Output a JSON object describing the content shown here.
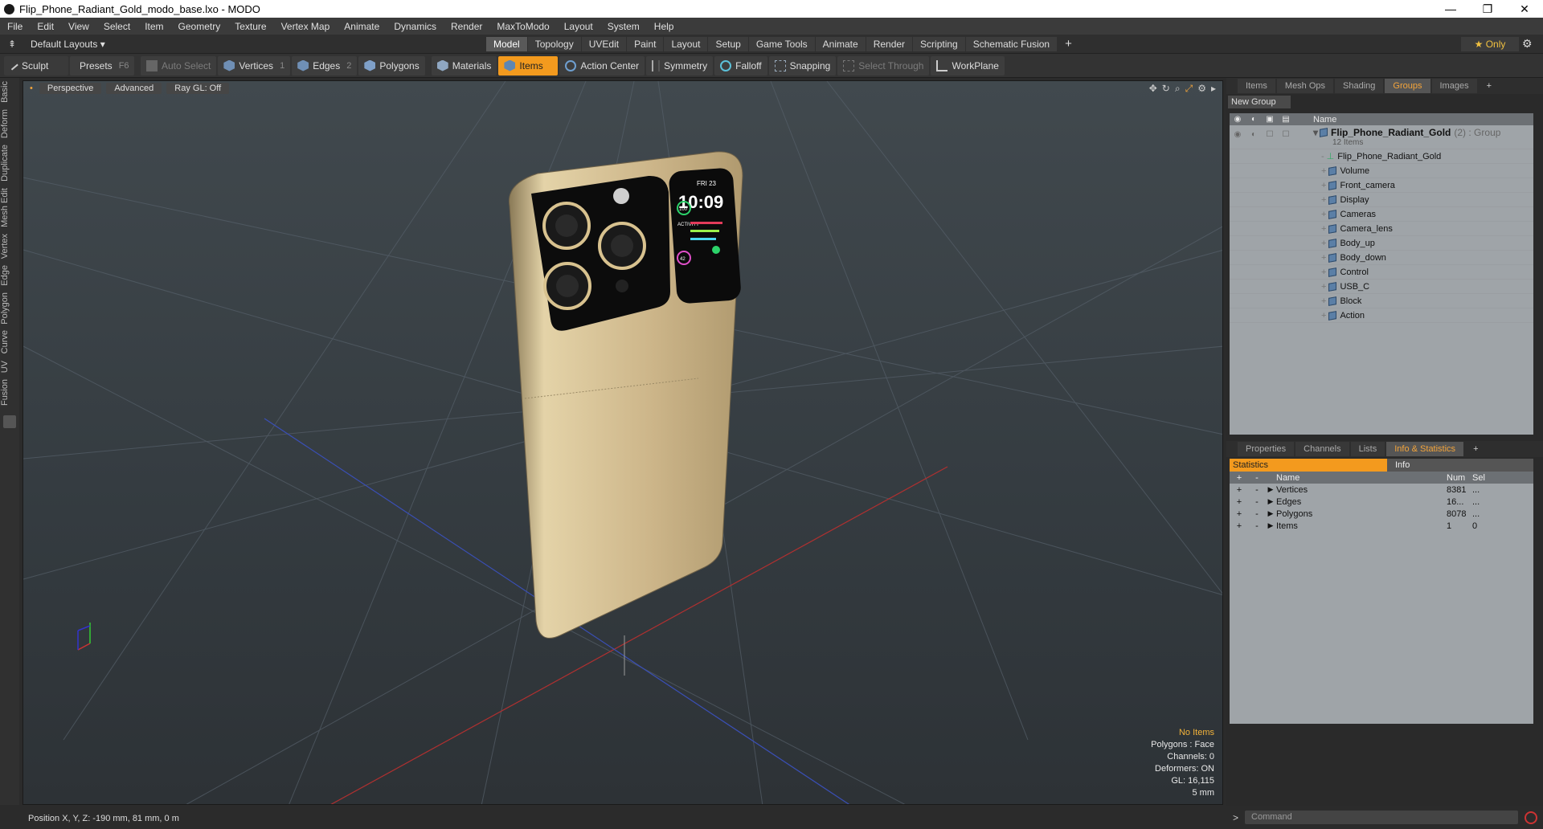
{
  "window": {
    "title": "Flip_Phone_Radiant_Gold_modo_base.lxo - MODO",
    "minimize": "—",
    "maximize": "❐",
    "close": "✕"
  },
  "menu": [
    "File",
    "Edit",
    "View",
    "Select",
    "Item",
    "Geometry",
    "Texture",
    "Vertex Map",
    "Animate",
    "Dynamics",
    "Render",
    "MaxToModo",
    "Layout",
    "System",
    "Help"
  ],
  "layout": {
    "label": "Default Layouts ▾",
    "tabs": [
      "Model",
      "Topology",
      "UVEdit",
      "Paint",
      "Layout",
      "Setup",
      "Game Tools",
      "Animate",
      "Render",
      "Scripting",
      "Schematic Fusion"
    ],
    "active_tab": "Model",
    "add": "+",
    "only": "★  Only",
    "gear": "⚙"
  },
  "toolbar": {
    "sculpt": "Sculpt",
    "presets": "Presets",
    "presets_key": "F6",
    "auto_select": "Auto Select",
    "vertices": "Vertices",
    "vertices_num": "1",
    "edges": "Edges",
    "edges_num": "2",
    "polygons": "Polygons",
    "materials": "Materials",
    "items": "Items",
    "action_center": "Action Center",
    "symmetry": "Symmetry",
    "falloff": "Falloff",
    "snapping": "Snapping",
    "select_through": "Select Through",
    "workplane": "WorkPlane"
  },
  "left_tabs": [
    "Basic",
    "Deform",
    "Duplicate",
    "Mesh Edit",
    "Vertex",
    "Edge",
    "Polygon",
    "Curve",
    "UV",
    "Fusion"
  ],
  "viewport": {
    "view": "Perspective",
    "mode": "Advanced",
    "raygl": "Ray GL: Off",
    "info": {
      "no_items": "No Items",
      "polygons": "Polygons : Face",
      "channels": "Channels: 0",
      "deformers": "Deformers: ON",
      "gl": "GL: 16,115",
      "scale": "5 mm"
    },
    "phone_screen": {
      "date": "FRI 23",
      "time": "10:09",
      "left": "100",
      "bottom": "42",
      "activity": "ACTIVITY"
    }
  },
  "status": {
    "position": "Position X, Y, Z:  -190 mm, 81 mm, 0 m"
  },
  "top_panel": {
    "tabs": [
      "Items",
      "Mesh Ops",
      "Shading",
      "Groups",
      "Images"
    ],
    "active": "Groups",
    "add": "+",
    "new_group": "New Group",
    "col_name": "Name",
    "group": {
      "name": "Flip_Phone_Radiant_Gold",
      "suffix": "(2) : Group",
      "count": "12 Items"
    },
    "items": [
      "Flip_Phone_Radiant_Gold",
      "Volume",
      "Front_camera",
      "Display",
      "Cameras",
      "Camera_lens",
      "Body_up",
      "Body_down",
      "Control",
      "USB_C",
      "Block",
      "Action"
    ]
  },
  "bottom_panel": {
    "tabs": [
      "Properties",
      "Channels",
      "Lists",
      "Info & Statistics"
    ],
    "active": "Info & Statistics",
    "add": "+",
    "stat_tab": "Statistics",
    "info_tab": "Info",
    "cols": {
      "name": "Name",
      "num": "Num",
      "sel": "Sel"
    },
    "rows": [
      {
        "name": "Vertices",
        "num": "8381",
        "sel": "..."
      },
      {
        "name": "Edges",
        "num": "16...",
        "sel": "..."
      },
      {
        "name": "Polygons",
        "num": "8078",
        "sel": "..."
      },
      {
        "name": "Items",
        "num": "1",
        "sel": "0"
      }
    ]
  },
  "command": {
    "prompt": ">",
    "placeholder": "Command"
  }
}
